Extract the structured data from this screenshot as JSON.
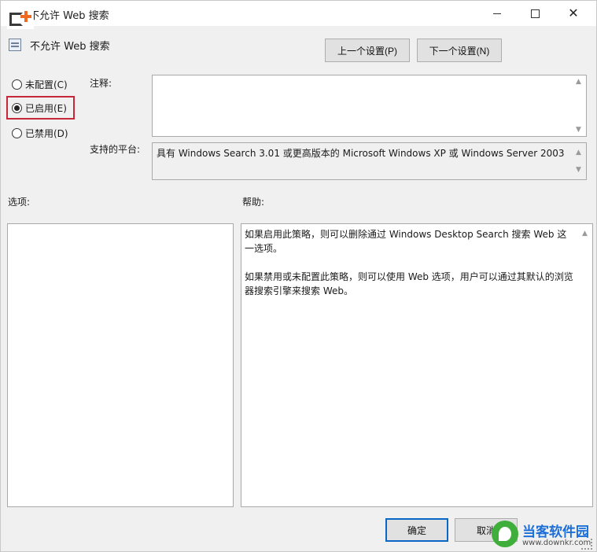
{
  "window": {
    "title": "不允许 Web 搜索",
    "minimize_icon": "minimize-icon",
    "maximize_icon": "maximize-icon",
    "close_icon": "close-icon",
    "close_glyph": "✕"
  },
  "policy": {
    "name": "不允许 Web 搜索",
    "icon": "policy-settings-icon"
  },
  "nav": {
    "prev_label": "上一个设置(P)",
    "next_label": "下一个设置(N)"
  },
  "state": {
    "options": [
      {
        "label": "未配置(C)",
        "selected": false
      },
      {
        "label": "已启用(E)",
        "selected": true
      },
      {
        "label": "已禁用(D)",
        "selected": false
      }
    ],
    "highlight_color": "#c6283a"
  },
  "comment": {
    "label": "注释:",
    "value": ""
  },
  "platform": {
    "label": "支持的平台:",
    "value": "具有 Windows Search 3.01 或更高版本的 Microsoft Windows XP 或 Windows Server 2003"
  },
  "options_panel": {
    "label": "选项:"
  },
  "help_panel": {
    "label": "帮助:",
    "paragraphs": [
      "如果启用此策略，则可以删除通过 Windows Desktop Search 搜索 Web 这一选项。",
      "如果禁用或未配置此策略，则可以使用 Web 选项，用户可以通过其默认的浏览器搜索引擎来搜索 Web。"
    ]
  },
  "footer": {
    "ok_label": "确定",
    "cancel_label": "取消"
  },
  "watermark": {
    "name": "当客软件园",
    "url": "www.downkr.com",
    "color": "#1d6fd8"
  },
  "logo": {
    "icon": "add-logo-icon",
    "accent": "#ee6a22"
  }
}
